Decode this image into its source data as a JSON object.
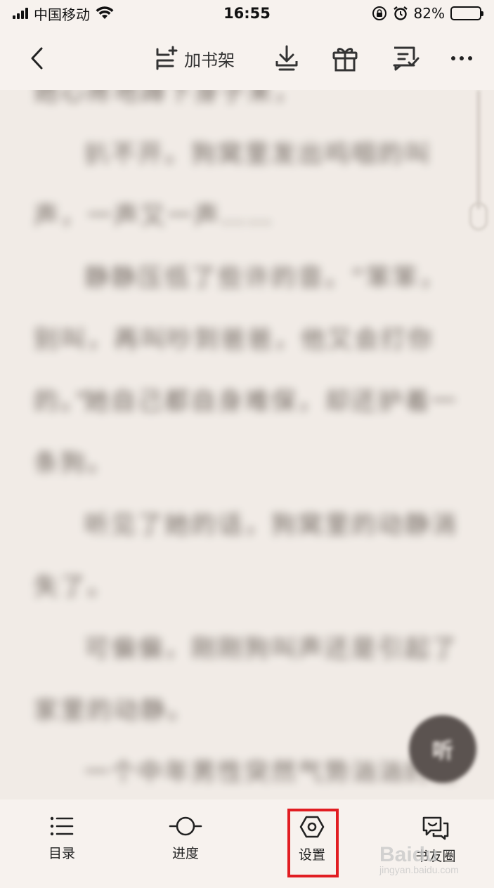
{
  "status_bar": {
    "carrier": "中国移动",
    "time": "16:55",
    "battery_percent": "82%",
    "battery_level": 0.82
  },
  "top_bar": {
    "add_to_shelf_label": "加书架"
  },
  "reading": {
    "paragraphs": [
      "她心疼地蹲下身子来，",
      "扒不开。狗窝里发出呜咽的叫声，一声又一声……",
      "静静压低了些许的音。“笨笨，别叫，再叫吵到爸爸，他又会打你的。”",
      "她自己都自身难保，却还护着一条狗。",
      "听见了她的话，狗窝里的动静消失了。",
      "可偏偏，刚刚狗叫声还是引起了家里的动静。",
      "一个中年男性突然气势汹汹的出来"
    ],
    "listen_button": "听"
  },
  "bottom_bar": {
    "toc_label": "目录",
    "progress_label": "进度",
    "settings_label": "设置",
    "friends_label": "书友圈"
  },
  "watermark": {
    "brand": "Baidu",
    "sub": "jingyan.baidu.com"
  },
  "colors": {
    "background": "#f1ebe6",
    "bar_background": "#f7f2ee",
    "highlight": "#e11d22"
  }
}
